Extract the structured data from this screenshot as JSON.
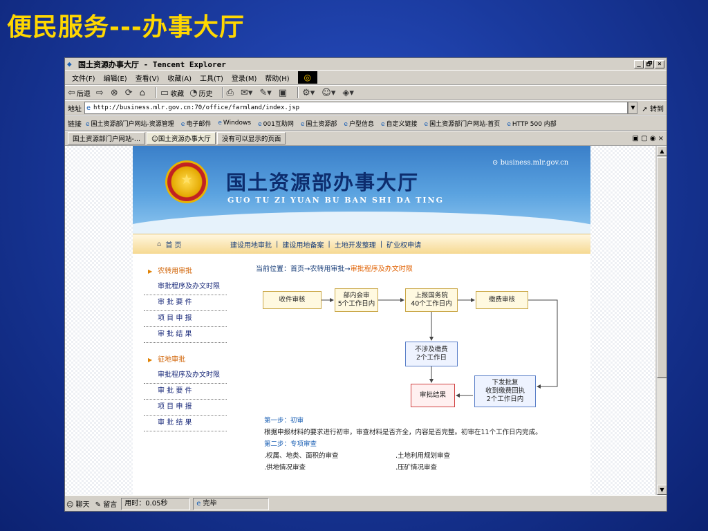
{
  "slide_title": "便民服务---办事大厅",
  "window": {
    "title": "国土资源办事大厅 - Tencent Explorer",
    "controls": [
      "_",
      "🗗",
      "×"
    ]
  },
  "menu": [
    "文件(F)",
    "编辑(E)",
    "查看(V)",
    "收藏(A)",
    "工具(T)",
    "登录(M)",
    "帮助(H)"
  ],
  "toolbar": {
    "back": "后退",
    "favorites": "收藏",
    "history": "历史"
  },
  "address": {
    "label": "地址",
    "url": "http://business.mlr.gov.cn:70/office/farmland/index.jsp",
    "go": "转到"
  },
  "links": {
    "label": "链接",
    "items": [
      "国土资源部门户网站-资源管理",
      "电子邮件",
      "Windows",
      "001互助网",
      "国土资源部",
      "户型信息",
      "自定义链接",
      "国土资源部门户网站-首页",
      "HTTP 500 内部"
    ]
  },
  "tabs": [
    "国土资源部门户网站-...",
    "国土资源办事大厅",
    "没有可以显示的页面"
  ],
  "banner": {
    "title": "国土资源部办事大厅",
    "pinyin": "GUO TU ZI YUAN BU BAN SHI DA TING",
    "url": "business.mlr.gov.cn"
  },
  "nav": {
    "home": "首 页",
    "items": [
      "建设用地审批",
      "建设用地备案",
      "土地开发整理",
      "矿业权申请"
    ]
  },
  "sidebar": {
    "group1": {
      "title": "农转用审批",
      "items": [
        "审批程序及办文时限",
        "审 批 要 件",
        "项 目 申 报",
        "审 批 结 果"
      ]
    },
    "group2": {
      "title": "征地审批",
      "items": [
        "审批程序及办文时限",
        "审 批 要 件",
        "项 目 申 报",
        "审 批 结 果"
      ]
    }
  },
  "breadcrumb": {
    "prefix": "当前位置：首页→农转用审批→",
    "current": "审批程序及办文时限"
  },
  "flow": {
    "b1": "收件审核",
    "b2a": "部内会审",
    "b2b": "5个工作日内",
    "b3a": "上报国务院",
    "b3b": "40个工作日内",
    "b4": "缴费审核",
    "b5a": "不涉及缴费",
    "b5b": "2个工作日",
    "b6": "审批结果",
    "b7a": "下发批复",
    "b7b": "收到缴费回执",
    "b7c": "2个工作日内"
  },
  "steps": {
    "s1_title": "第一步：初审",
    "s1_body": "根据申报材料的要求进行初审，审查材料是否齐全，内容是否完整。初审在11个工作日内完成。",
    "s2_title": "第二步：专项审查",
    "r1a": ".权属、地类、面积的审查",
    "r1b": ".土地利用规划审查",
    "r2a": ".供地情况审查",
    "r2b": ".压矿情况审查"
  },
  "status": {
    "chat": "聊天",
    "message": "留言",
    "time": "用时：0.05秒",
    "done": "完毕"
  }
}
